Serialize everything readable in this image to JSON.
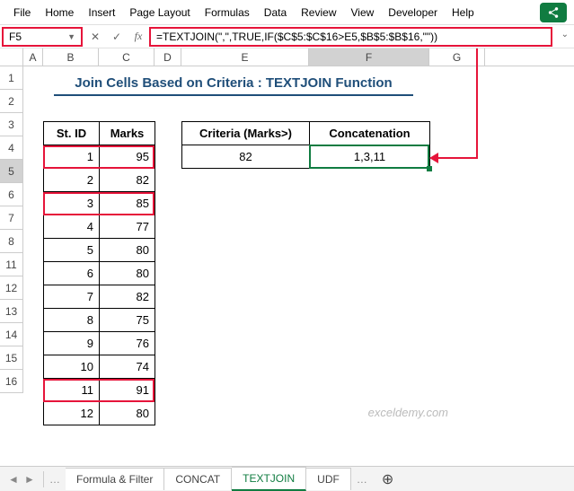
{
  "menu": {
    "items": [
      "File",
      "Home",
      "Insert",
      "Page Layout",
      "Formulas",
      "Data",
      "Review",
      "View",
      "Developer",
      "Help"
    ]
  },
  "namebox": "F5",
  "formula": "=TEXTJOIN(\",\",TRUE,IF($C$5:$C$16>E5,$B$5:$B$16,\"\"))",
  "title": "Join Cells Based on Criteria : TEXTJOIN Function",
  "columns": [
    "A",
    "B",
    "C",
    "D",
    "E",
    "F",
    "G"
  ],
  "row_labels": [
    "1",
    "2",
    "3",
    "4",
    "5",
    "6",
    "7",
    "8",
    "11",
    "12",
    "13",
    "14",
    "15",
    "16"
  ],
  "table": {
    "headers": [
      "St. ID",
      "Marks"
    ],
    "rows": [
      [
        1,
        95
      ],
      [
        2,
        82
      ],
      [
        3,
        85
      ],
      [
        4,
        77
      ],
      [
        5,
        80
      ],
      [
        6,
        80
      ],
      [
        7,
        82
      ],
      [
        8,
        75
      ],
      [
        9,
        76
      ],
      [
        10,
        74
      ],
      [
        11,
        91
      ],
      [
        12,
        80
      ]
    ]
  },
  "criteria": {
    "headers": [
      "Criteria (Marks>)",
      "Concatenation"
    ],
    "value": 82,
    "result": "1,3,11"
  },
  "sheets": {
    "tabs": [
      "Formula & Filter",
      "CONCAT",
      "TEXTJOIN",
      "UDF"
    ],
    "active": 2
  },
  "watermark": "exceldemy.com",
  "chart_data": {
    "type": "table",
    "title": "Join Cells Based on Criteria : TEXTJOIN Function",
    "categories": [
      "St. ID",
      "Marks"
    ],
    "series": [
      {
        "name": "St. ID",
        "values": [
          1,
          2,
          3,
          4,
          5,
          6,
          7,
          8,
          9,
          10,
          11,
          12
        ]
      },
      {
        "name": "Marks",
        "values": [
          95,
          82,
          85,
          77,
          80,
          80,
          82,
          75,
          76,
          74,
          91,
          80
        ]
      }
    ],
    "criteria_threshold": 82,
    "concatenation_result": "1,3,11"
  }
}
